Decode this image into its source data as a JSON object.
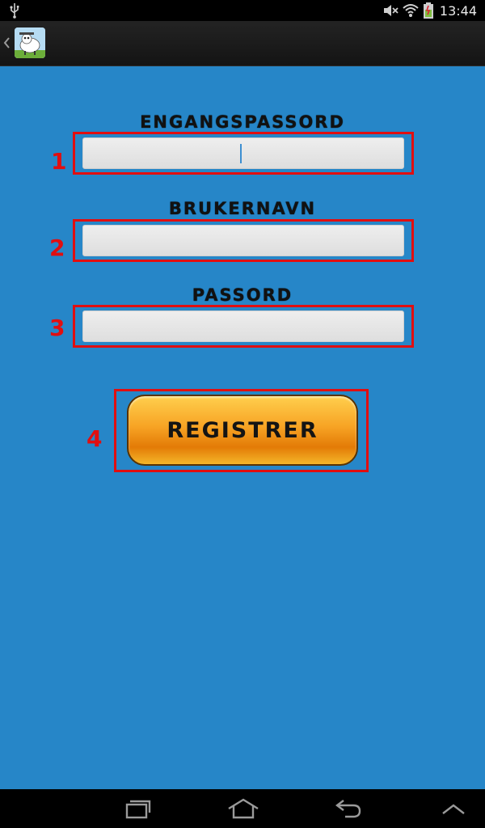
{
  "status_bar": {
    "time": "13:44",
    "icons": [
      "usb-icon",
      "mute-icon",
      "wifi-icon",
      "battery-icon"
    ]
  },
  "action_bar": {
    "icons": [
      "back-chevron-icon",
      "app-logo-icon"
    ]
  },
  "form": {
    "one_time_password": {
      "label": "ENGANGSPASSORD",
      "value": "",
      "badge": "1"
    },
    "username": {
      "label": "BRUKERNAVN",
      "value": "",
      "badge": "2"
    },
    "password": {
      "label": "PASSORD",
      "value": "",
      "badge": "3"
    },
    "register": {
      "label": "REGISTRER",
      "badge": "4"
    }
  },
  "colors": {
    "background": "#2686c8",
    "highlight": "#e10e10",
    "button": "#f7a324"
  },
  "nav_bar": {
    "icons": [
      "recent-apps-icon",
      "home-icon",
      "back-icon",
      "menu-up-icon"
    ]
  }
}
